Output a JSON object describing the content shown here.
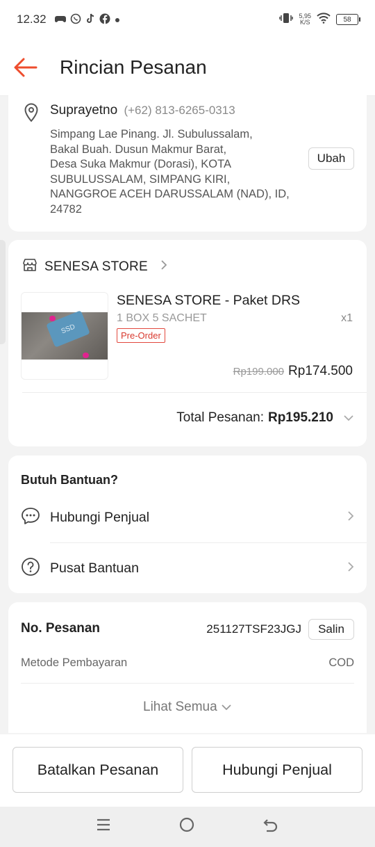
{
  "status_bar": {
    "time": "12.32",
    "net_speed_top": "5,95",
    "net_speed_unit": "K/S",
    "battery": "58"
  },
  "header": {
    "title": "Rincian Pesanan"
  },
  "address": {
    "name": "Suprayetno",
    "phone": "(+62) 813-6265-0313",
    "lines": [
      "Simpang Lae Pinang. Jl. Subulussalam,",
      "Bakal Buah. Dusun Makmur Barat,",
      "Desa Suka Makmur (Dorasi), KOTA",
      "SUBULUSSALAM, SIMPANG KIRI,",
      "NANGGROE ACEH DARUSSALAM (NAD), ID,",
      "24782"
    ],
    "edit_label": "Ubah"
  },
  "store": {
    "name": "SENESA STORE",
    "product": {
      "name": "SENESA STORE - Paket DRS",
      "variant": "1 BOX 5 SACHET",
      "qty": "x1",
      "badge": "Pre-Order",
      "image_text": "SSD",
      "price_old": "Rp199.000",
      "price_new": "Rp174.500"
    },
    "total_label": "Total Pesanan:",
    "total_value": "Rp195.210"
  },
  "help": {
    "title": "Butuh Bantuan?",
    "items": [
      {
        "label": "Hubungi Penjual",
        "icon": "chat-icon"
      },
      {
        "label": "Pusat Bantuan",
        "icon": "question-icon"
      }
    ]
  },
  "order": {
    "no_label": "No. Pesanan",
    "no_value": "251127TSF23JGJ",
    "copy_label": "Salin",
    "payment_label": "Metode Pembayaran",
    "payment_value": "COD",
    "see_all": "Lihat Semua"
  },
  "actions": {
    "cancel": "Batalkan Pesanan",
    "contact": "Hubungi Penjual"
  },
  "colors": {
    "accent": "#ee4d2d",
    "preorder": "#d8392e"
  }
}
